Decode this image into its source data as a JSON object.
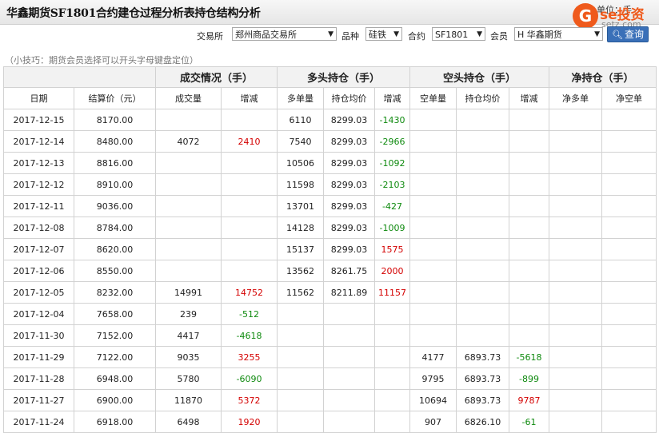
{
  "title": "华鑫期货SF1801合约建仓过程分析表持仓结构分析",
  "unit_text": "单位：手",
  "logo": {
    "mark": "G",
    "text": "se投资",
    "sub": "setz.com"
  },
  "filters": {
    "exchange_label": "交易所",
    "exchange_value": "郑州商品交易所",
    "variety_label": "品种",
    "variety_value": "硅铁",
    "contract_label": "合约",
    "contract_value": "SF1801",
    "member_label": "会员",
    "member_value": "H 华鑫期货",
    "query_label": "查询"
  },
  "tip": "（小技巧：期货会员选择可以开头字母键盘定位）",
  "groups": [
    "成交情况（手）",
    "多头持仓（手）",
    "空头持仓（手）",
    "净持仓（手）"
  ],
  "columns": [
    "日期",
    "结算价（元）",
    "成交量",
    "增减",
    "多单量",
    "持仓均价",
    "增减",
    "空单量",
    "持仓均价",
    "增减",
    "净多单",
    "净空单"
  ],
  "rows": [
    [
      "2017-12-15",
      "8170.00",
      "",
      "",
      "6110",
      "8299.03",
      "-1430",
      "",
      "",
      "",
      "",
      ""
    ],
    [
      "2017-12-14",
      "8480.00",
      "4072",
      "2410",
      "7540",
      "8299.03",
      "-2966",
      "",
      "",
      "",
      "",
      ""
    ],
    [
      "2017-12-13",
      "8816.00",
      "",
      "",
      "10506",
      "8299.03",
      "-1092",
      "",
      "",
      "",
      "",
      ""
    ],
    [
      "2017-12-12",
      "8910.00",
      "",
      "",
      "11598",
      "8299.03",
      "-2103",
      "",
      "",
      "",
      "",
      ""
    ],
    [
      "2017-12-11",
      "9036.00",
      "",
      "",
      "13701",
      "8299.03",
      "-427",
      "",
      "",
      "",
      "",
      ""
    ],
    [
      "2017-12-08",
      "8784.00",
      "",
      "",
      "14128",
      "8299.03",
      "-1009",
      "",
      "",
      "",
      "",
      ""
    ],
    [
      "2017-12-07",
      "8620.00",
      "",
      "",
      "15137",
      "8299.03",
      "1575",
      "",
      "",
      "",
      "",
      ""
    ],
    [
      "2017-12-06",
      "8550.00",
      "",
      "",
      "13562",
      "8261.75",
      "2000",
      "",
      "",
      "",
      "",
      ""
    ],
    [
      "2017-12-05",
      "8232.00",
      "14991",
      "14752",
      "11562",
      "8211.89",
      "11157",
      "",
      "",
      "",
      "",
      ""
    ],
    [
      "2017-12-04",
      "7658.00",
      "239",
      "-512",
      "",
      "",
      "",
      "",
      "",
      "",
      "",
      ""
    ],
    [
      "2017-11-30",
      "7152.00",
      "4417",
      "-4618",
      "",
      "",
      "",
      "",
      "",
      "",
      "",
      ""
    ],
    [
      "2017-11-29",
      "7122.00",
      "9035",
      "3255",
      "",
      "",
      "",
      "4177",
      "6893.73",
      "-5618",
      "",
      ""
    ],
    [
      "2017-11-28",
      "6948.00",
      "5780",
      "-6090",
      "",
      "",
      "",
      "9795",
      "6893.73",
      "-899",
      "",
      ""
    ],
    [
      "2017-11-27",
      "6900.00",
      "11870",
      "5372",
      "",
      "",
      "",
      "10694",
      "6893.73",
      "9787",
      "",
      ""
    ],
    [
      "2017-11-24",
      "6918.00",
      "6498",
      "1920",
      "",
      "",
      "",
      "907",
      "6826.10",
      "-61",
      "",
      ""
    ]
  ],
  "colors": {
    "positive": "#d40000",
    "negative": "#0f8a0f",
    "header_bg": "#f2f2f2",
    "button": "#3a70b8",
    "logo": "#ef5a1c"
  }
}
